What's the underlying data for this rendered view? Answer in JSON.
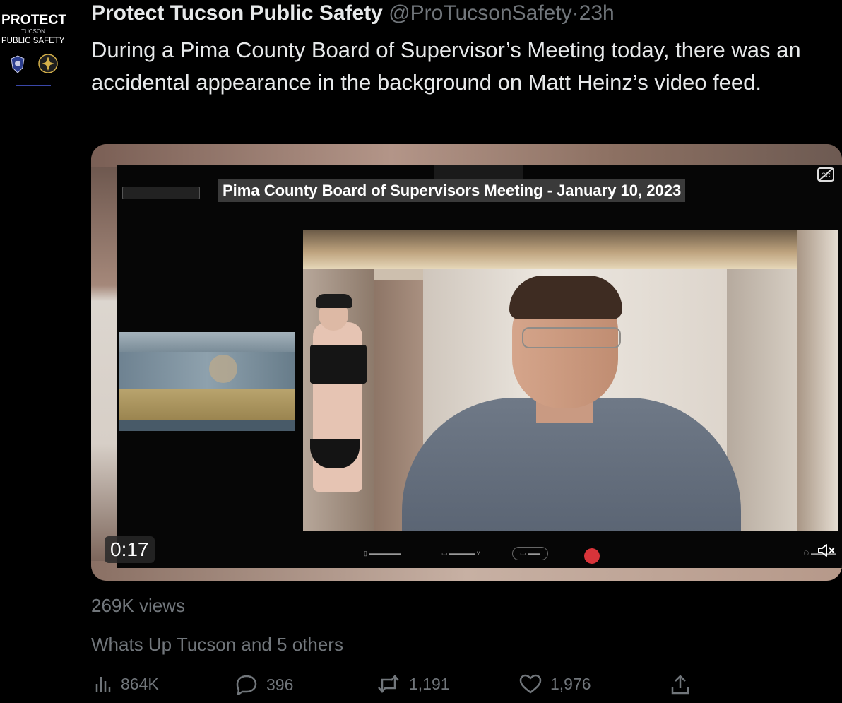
{
  "avatar": {
    "line1": "PROTECT",
    "line2": "TUCSON",
    "line3": "PUBLIC SAFETY",
    "badge_icons": [
      "police-badge-icon",
      "fire-badge-icon"
    ]
  },
  "tweet": {
    "author_name": "Protect Tucson Public Safety",
    "handle": "@ProTucsonSafety",
    "separator": "·",
    "time": "23h",
    "text": "During a Pima County Board of Supervisor’s Meeting today, there was an accidental appearance in the background on Matt Heinz’s video feed."
  },
  "video": {
    "meeting_title": "Pima County Board of Supervisors Meeting - January 10, 2023",
    "duration": "0:17",
    "cc_icon": "closed-captions-icon",
    "mute_icon": "speaker-muted-icon"
  },
  "stats": {
    "views": "269K views",
    "liked_by": "Whats Up Tucson and 5 others"
  },
  "actions": {
    "views_count": "864K",
    "replies": "396",
    "retweets": "1,191",
    "likes": "1,976"
  },
  "colors": {
    "background": "#000000",
    "text_primary": "#e7e9ea",
    "text_secondary": "#71767b",
    "end_call": "#d8343a"
  }
}
